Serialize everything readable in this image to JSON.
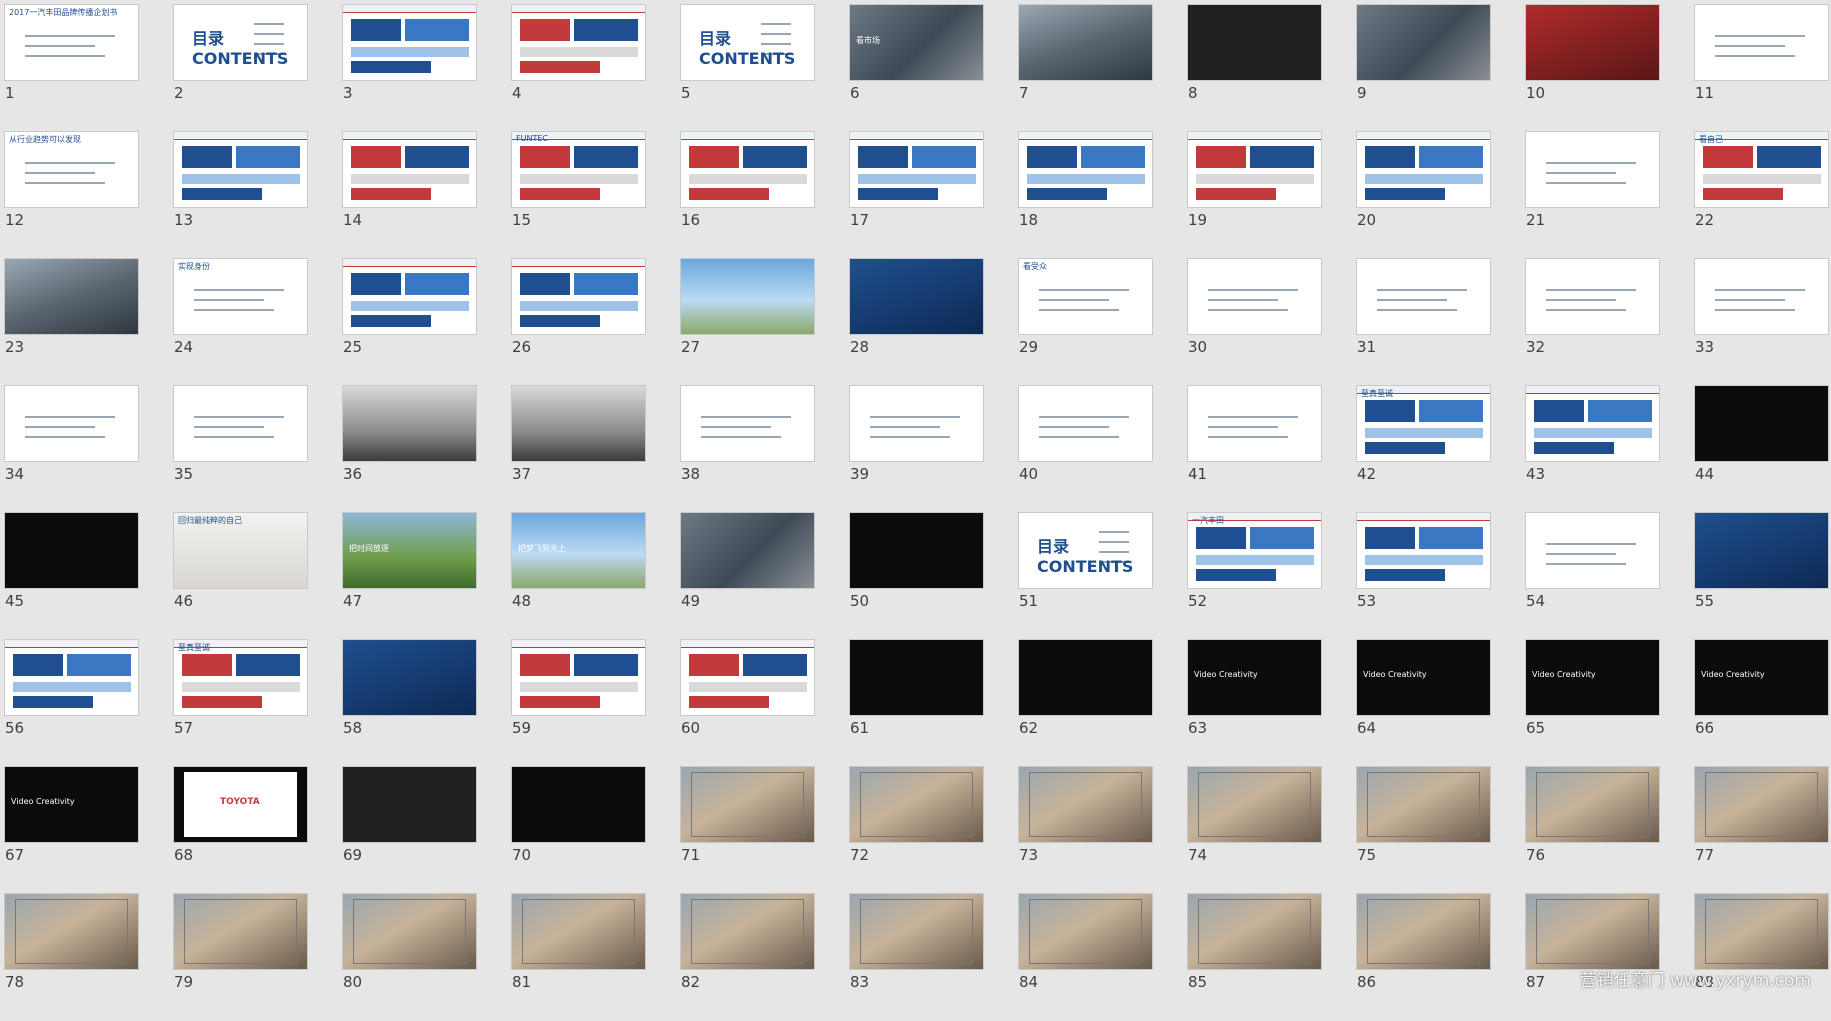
{
  "slides": [
    {
      "n": "1",
      "style": "white",
      "title": "2017一汽丰田品牌传播企划书"
    },
    {
      "n": "2",
      "style": "contents",
      "title": "目录 CONTENTS"
    },
    {
      "n": "3",
      "style": "white-blue",
      "title": ""
    },
    {
      "n": "4",
      "style": "white-red",
      "title": ""
    },
    {
      "n": "5",
      "style": "contents",
      "title": "目录 CONTENTS"
    },
    {
      "n": "6",
      "style": "photo",
      "title": "看市场"
    },
    {
      "n": "7",
      "style": "street",
      "title": ""
    },
    {
      "n": "8",
      "style": "dark",
      "title": ""
    },
    {
      "n": "9",
      "style": "photo",
      "title": ""
    },
    {
      "n": "10",
      "style": "red",
      "title": ""
    },
    {
      "n": "11",
      "style": "white",
      "title": ""
    },
    {
      "n": "12",
      "style": "white",
      "title": "从行业趋势可以发现"
    },
    {
      "n": "13",
      "style": "white-blue",
      "title": ""
    },
    {
      "n": "14",
      "style": "white-red",
      "title": ""
    },
    {
      "n": "15",
      "style": "white-red",
      "title": "FUNTEC"
    },
    {
      "n": "16",
      "style": "white-red",
      "title": ""
    },
    {
      "n": "17",
      "style": "white-blue",
      "title": ""
    },
    {
      "n": "18",
      "style": "white-blue",
      "title": ""
    },
    {
      "n": "19",
      "style": "white-red",
      "title": ""
    },
    {
      "n": "20",
      "style": "white-blue",
      "title": ""
    },
    {
      "n": "21",
      "style": "white",
      "title": ""
    },
    {
      "n": "22",
      "style": "white-red",
      "title": "看自己"
    },
    {
      "n": "23",
      "style": "street",
      "title": ""
    },
    {
      "n": "24",
      "style": "white",
      "title": "实现身份"
    },
    {
      "n": "25",
      "style": "white-blue",
      "title": ""
    },
    {
      "n": "26",
      "style": "white-blue",
      "title": ""
    },
    {
      "n": "27",
      "style": "sky",
      "title": ""
    },
    {
      "n": "28",
      "style": "blue",
      "title": ""
    },
    {
      "n": "29",
      "style": "white",
      "title": "看受众"
    },
    {
      "n": "30",
      "style": "white",
      "title": ""
    },
    {
      "n": "31",
      "style": "white",
      "title": ""
    },
    {
      "n": "32",
      "style": "white",
      "title": ""
    },
    {
      "n": "33",
      "style": "white",
      "title": ""
    },
    {
      "n": "34",
      "style": "white",
      "title": ""
    },
    {
      "n": "35",
      "style": "white",
      "title": ""
    },
    {
      "n": "36",
      "style": "road",
      "title": ""
    },
    {
      "n": "37",
      "style": "road",
      "title": ""
    },
    {
      "n": "38",
      "style": "white",
      "title": ""
    },
    {
      "n": "39",
      "style": "white",
      "title": ""
    },
    {
      "n": "40",
      "style": "white",
      "title": ""
    },
    {
      "n": "41",
      "style": "white",
      "title": ""
    },
    {
      "n": "42",
      "style": "white-blue",
      "title": "至真至诚"
    },
    {
      "n": "43",
      "style": "white-blue",
      "title": ""
    },
    {
      "n": "44",
      "style": "black",
      "title": ""
    },
    {
      "n": "45",
      "style": "black",
      "title": ""
    },
    {
      "n": "46",
      "style": "room",
      "title": "回归最纯粹的自己"
    },
    {
      "n": "47",
      "style": "green",
      "title": "把时间放逐"
    },
    {
      "n": "48",
      "style": "sky",
      "title": "把梦飞到天上"
    },
    {
      "n": "49",
      "style": "photo",
      "title": ""
    },
    {
      "n": "50",
      "style": "black",
      "title": ""
    },
    {
      "n": "51",
      "style": "contents",
      "title": "目录 CONTENTS"
    },
    {
      "n": "52",
      "style": "white-blue",
      "title": "一汽丰田"
    },
    {
      "n": "53",
      "style": "white-blue",
      "title": ""
    },
    {
      "n": "54",
      "style": "white",
      "title": ""
    },
    {
      "n": "55",
      "style": "blue",
      "title": ""
    },
    {
      "n": "56",
      "style": "white-blue",
      "title": ""
    },
    {
      "n": "57",
      "style": "white-red",
      "title": "至真至诚"
    },
    {
      "n": "58",
      "style": "blue",
      "title": ""
    },
    {
      "n": "59",
      "style": "white-red",
      "title": ""
    },
    {
      "n": "60",
      "style": "white-red",
      "title": ""
    },
    {
      "n": "61",
      "style": "black",
      "title": ""
    },
    {
      "n": "62",
      "style": "black",
      "title": ""
    },
    {
      "n": "63",
      "style": "black",
      "title": "Video Creativity"
    },
    {
      "n": "64",
      "style": "black",
      "title": "Video Creativity"
    },
    {
      "n": "65",
      "style": "black",
      "title": "Video Creativity"
    },
    {
      "n": "66",
      "style": "black",
      "title": "Video Creativity"
    },
    {
      "n": "67",
      "style": "black",
      "title": "Video Creativity"
    },
    {
      "n": "68",
      "style": "toyota",
      "title": "TOYOTA"
    },
    {
      "n": "69",
      "style": "dark",
      "title": ""
    },
    {
      "n": "70",
      "style": "black",
      "title": ""
    },
    {
      "n": "71",
      "style": "comic",
      "title": ""
    },
    {
      "n": "72",
      "style": "comic",
      "title": ""
    },
    {
      "n": "73",
      "style": "comic",
      "title": ""
    },
    {
      "n": "74",
      "style": "comic",
      "title": ""
    },
    {
      "n": "75",
      "style": "comic",
      "title": ""
    },
    {
      "n": "76",
      "style": "comic",
      "title": ""
    },
    {
      "n": "77",
      "style": "comic",
      "title": ""
    },
    {
      "n": "78",
      "style": "comic",
      "title": ""
    },
    {
      "n": "79",
      "style": "comic",
      "title": ""
    },
    {
      "n": "80",
      "style": "comic",
      "title": ""
    },
    {
      "n": "81",
      "style": "comic",
      "title": ""
    },
    {
      "n": "82",
      "style": "comic",
      "title": ""
    },
    {
      "n": "83",
      "style": "comic",
      "title": ""
    },
    {
      "n": "84",
      "style": "comic",
      "title": ""
    },
    {
      "n": "85",
      "style": "comic",
      "title": ""
    },
    {
      "n": "86",
      "style": "comic",
      "title": ""
    },
    {
      "n": "87",
      "style": "comic",
      "title": ""
    },
    {
      "n": "88",
      "style": "comic",
      "title": ""
    }
  ],
  "watermark": "营销任意门 www.yxrym.com"
}
